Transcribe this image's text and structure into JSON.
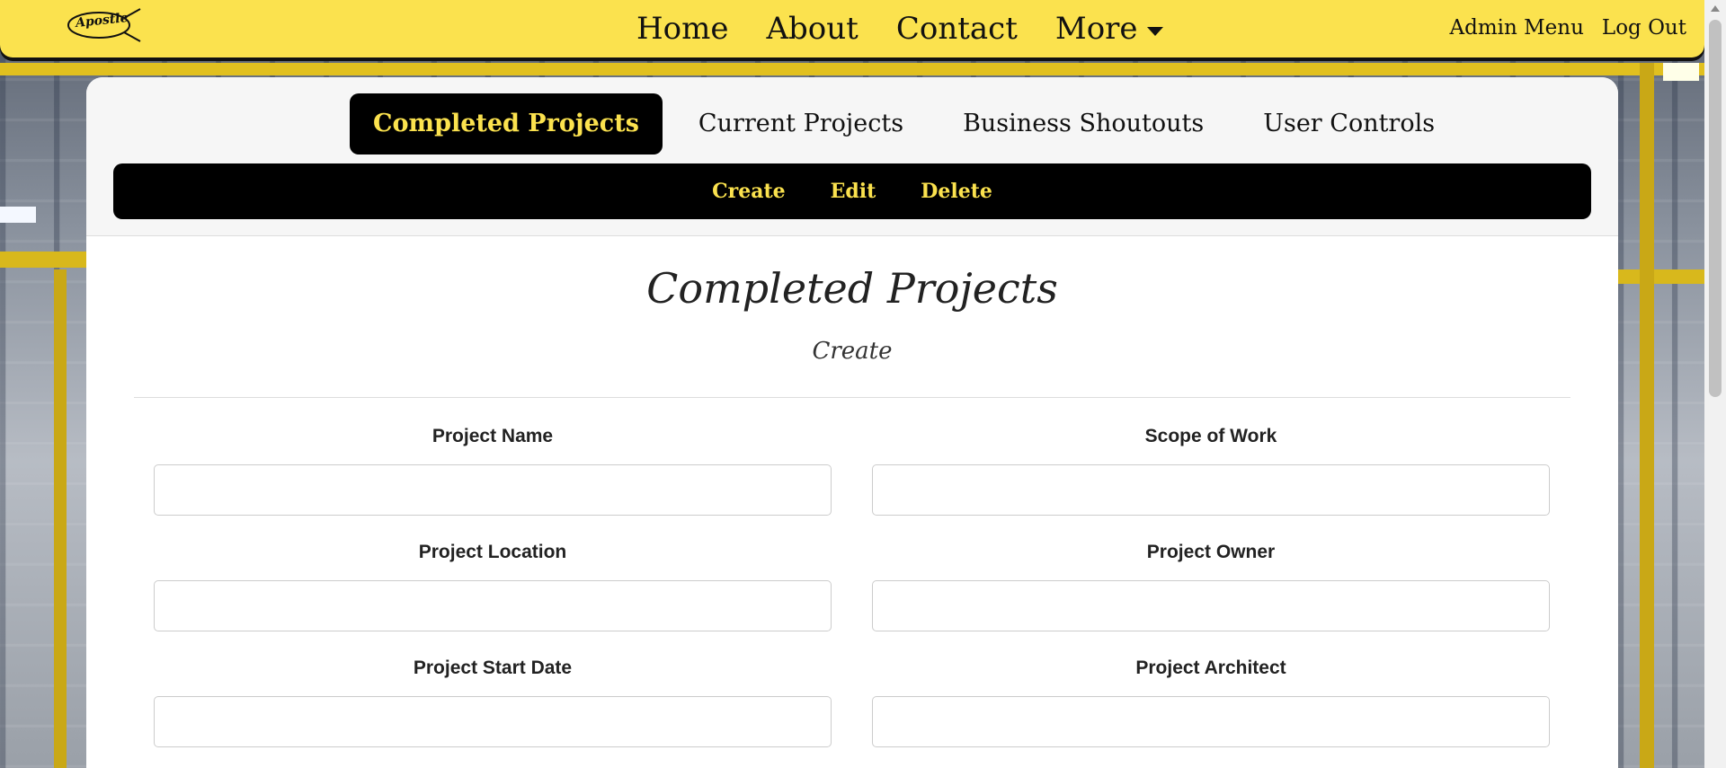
{
  "brand": {
    "logo_text": "Apostle"
  },
  "nav": {
    "links": [
      "Home",
      "About",
      "Contact",
      "More"
    ],
    "right": [
      "Admin Menu",
      "Log Out"
    ]
  },
  "panel": {
    "tabs": [
      "Completed Projects",
      "Current Projects",
      "Business Shoutouts",
      "User Controls"
    ],
    "active_tab": "Completed Projects",
    "actions": [
      "Create",
      "Edit",
      "Delete"
    ]
  },
  "content": {
    "title": "Completed Projects",
    "subtitle": "Create"
  },
  "form": {
    "fields": [
      {
        "label": "Project Name",
        "value": ""
      },
      {
        "label": "Scope of Work",
        "value": ""
      },
      {
        "label": "Project Location",
        "value": ""
      },
      {
        "label": "Project Owner",
        "value": ""
      },
      {
        "label": "Project Start Date",
        "value": ""
      },
      {
        "label": "Project Architect",
        "value": ""
      }
    ]
  },
  "colors": {
    "accent": "#fbe24e",
    "dark": "#000000"
  }
}
